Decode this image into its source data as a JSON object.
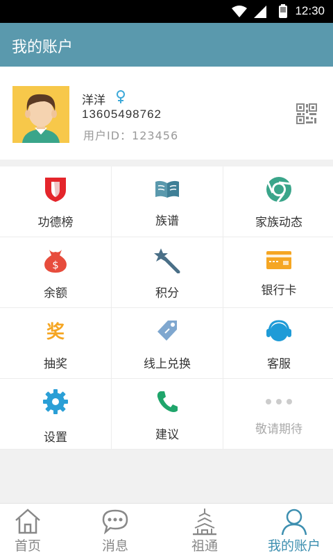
{
  "status": {
    "time": "12:30"
  },
  "header": {
    "title": "我的账户"
  },
  "profile": {
    "name": "洋洋",
    "phone": "13605498762",
    "user_id": "用户ID：123456"
  },
  "grid": {
    "items": [
      {
        "label": "功德榜",
        "icon": "shield-icon",
        "color": "#e4252b"
      },
      {
        "label": "族谱",
        "icon": "book-icon",
        "color": "#5a99ad"
      },
      {
        "label": "家族动态",
        "icon": "chrome-icon",
        "color": "#3aa58a"
      },
      {
        "label": "余额",
        "icon": "money-bag-icon",
        "color": "#e74c3c"
      },
      {
        "label": "积分",
        "icon": "magic-wand-icon",
        "color": "#4a6f87"
      },
      {
        "label": "银行卡",
        "icon": "bank-card-icon",
        "color": "#f5a623"
      },
      {
        "label": "抽奖",
        "icon": "prize-icon",
        "color": "#f5a623"
      },
      {
        "label": "线上兑换",
        "icon": "tag-icon",
        "color": "#7fa7cf"
      },
      {
        "label": "客服",
        "icon": "headset-icon",
        "color": "#1e9bd7"
      },
      {
        "label": "设置",
        "icon": "gear-icon",
        "color": "#2a9fd6"
      },
      {
        "label": "建议",
        "icon": "phone-icon",
        "color": "#1fa56b"
      },
      {
        "label": "敬请期待",
        "icon": "more-dots-icon",
        "color": "#cccccc"
      }
    ]
  },
  "tabs": [
    {
      "label": "首页",
      "icon": "home-icon"
    },
    {
      "label": "消息",
      "icon": "chat-icon"
    },
    {
      "label": "祖通",
      "icon": "tower-icon"
    },
    {
      "label": "我的账户",
      "icon": "person-icon"
    }
  ],
  "colors": {
    "header": "#5a99ad",
    "active_tab": "#3d8fb0"
  }
}
